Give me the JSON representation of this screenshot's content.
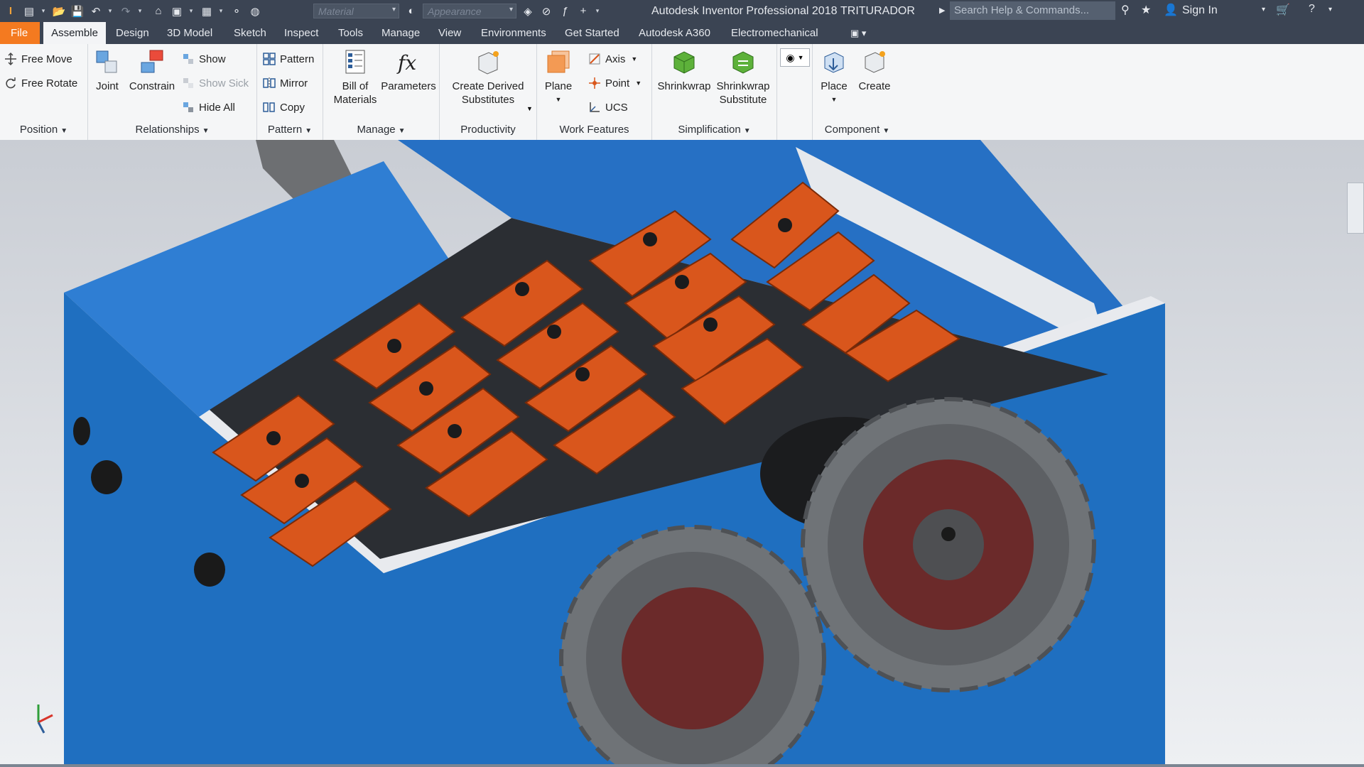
{
  "titlebar": {
    "app_title": "Autodesk Inventor Professional 2018",
    "document": "TRITURADOR",
    "material_placeholder": "Material",
    "appearance_placeholder": "Appearance",
    "search_placeholder": "Search Help & Commands...",
    "sign_in": "Sign In"
  },
  "tabs": {
    "file": "File",
    "items": [
      "Assemble",
      "Design",
      "3D Model",
      "Sketch",
      "Inspect",
      "Tools",
      "Manage",
      "View",
      "Environments",
      "Get Started",
      "Autodesk A360",
      "Electromechanical"
    ]
  },
  "ribbon": {
    "position": {
      "label": "Position",
      "free_move": "Free Move",
      "free_rotate": "Free Rotate"
    },
    "relationships": {
      "label": "Relationships",
      "joint": "Joint",
      "constrain": "Constrain",
      "show": "Show",
      "show_sick": "Show Sick",
      "hide_all": "Hide All"
    },
    "pattern": {
      "label": "Pattern",
      "pattern": "Pattern",
      "mirror": "Mirror",
      "copy": "Copy"
    },
    "manage": {
      "label": "Manage",
      "bom_line1": "Bill of",
      "bom_line2": "Materials",
      "parameters": "Parameters"
    },
    "productivity": {
      "label": "Productivity",
      "line1": "Create Derived",
      "line2": "Substitutes"
    },
    "work_features": {
      "label": "Work Features",
      "plane": "Plane",
      "axis": "Axis",
      "point": "Point",
      "ucs": "UCS"
    },
    "simplification": {
      "label": "Simplification",
      "shrinkwrap": "Shrinkwrap",
      "sub_line1": "Shrinkwrap",
      "sub_line2": "Substitute"
    },
    "component": {
      "label": "Component",
      "place": "Place",
      "create": "Create"
    }
  },
  "colors": {
    "chrome": "#3b4453",
    "file_tab": "#f47a20",
    "housing_blue": "#1f6fc0",
    "blades_orange": "#d9561c",
    "gear_gray": "#6f7377",
    "hub_red": "#6b2a2a"
  }
}
